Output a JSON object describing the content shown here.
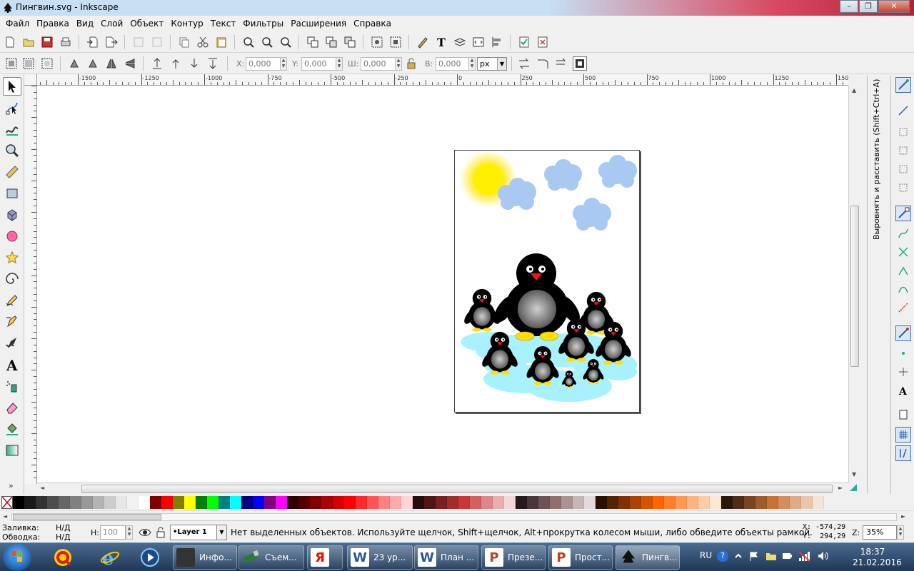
{
  "window": {
    "title": "Пингвин.svg - Inkscape"
  },
  "menu": [
    "Файл",
    "Правка",
    "Вид",
    "Слой",
    "Объект",
    "Контур",
    "Текст",
    "Фильтры",
    "Расширения",
    "Справка"
  ],
  "controls": {
    "x_label": "X:",
    "x_value": "0,000",
    "y_label": "Y:",
    "y_value": "0,000",
    "w_label": "Ш:",
    "w_value": "0,000",
    "h_label": "В:",
    "h_value": "0,000",
    "unit": "px"
  },
  "ruler": {
    "labels": [
      "-1500",
      "-1250",
      "-1000",
      "-750",
      "-500",
      "-250",
      "0",
      "250",
      "500",
      "750",
      "1000",
      "1250",
      "1500"
    ]
  },
  "dock": {
    "panel_title": "Выровнять и расставить (Shift+Ctrl+A)"
  },
  "status": {
    "fill_label": "Заливка:",
    "fill_value": "Н/Д",
    "stroke_label": "Обводка:",
    "stroke_value": "Н/Д",
    "opacity_label": "Н:",
    "opacity_value": "100",
    "layer": "•Layer 1",
    "message": "Нет выделенных объектов. Используйте щелчок, Shift+щелчок, Alt+прокрутка колесом мыши, либо обведите объекты рамкой.",
    "cursor_x": "X: -574,29",
    "cursor_y": "Y:  294,29",
    "zoom_label": "Z:",
    "zoom_value": "35%"
  },
  "palette": [
    "#000000",
    "#1a1a1a",
    "#333333",
    "#4d4d4d",
    "#666666",
    "#808080",
    "#999999",
    "#b3b3b3",
    "#cccccc",
    "#e6e6e6",
    "#f2f2f2",
    "#ffffff",
    "#800000",
    "#ff0000",
    "#808000",
    "#ffff00",
    "#008000",
    "#00ff00",
    "#008080",
    "#00ffff",
    "#000080",
    "#0000ff",
    "#800080",
    "#ff00ff",
    "#2b0000",
    "#550000",
    "#800000",
    "#aa0000",
    "#d40000",
    "#ff0000",
    "#ff2a2a",
    "#ff5555",
    "#ff8080",
    "#ffaaaa",
    "#ffd5d5",
    "#280b0b",
    "#501616",
    "#782121",
    "#a02c2c",
    "#c83737",
    "#d35f5f",
    "#de8787",
    "#e9afaf",
    "#f4d7d7",
    "#241c1c",
    "#483737",
    "#6c5353",
    "#916f6f",
    "#ac9393",
    "#c8b7b7",
    "#e3dbdb",
    "#2b1100",
    "#552200",
    "#803300",
    "#aa4400",
    "#d45500",
    "#ff6600",
    "#ff7f2a",
    "#ff9955",
    "#ffb380",
    "#ffccaa",
    "#ffe6d5",
    "#28170b",
    "#502d16",
    "#784421",
    "#a05a2c",
    "#c87137",
    "#d38d5f",
    "#deaa87",
    "#e9c6af",
    "#f4e3d7"
  ],
  "taskbar": {
    "tasks": [
      {
        "label": "Инфо...",
        "icon": "film-icon",
        "color": "#333333"
      },
      {
        "label": "Съем...",
        "icon": "usb-icon",
        "color": "#2a7a3a"
      },
      {
        "label": "",
        "icon": "yandex-icon",
        "color": "#ffffff"
      },
      {
        "label": "23 ур...",
        "icon": "word-icon",
        "color": "#2b579a"
      },
      {
        "label": "План ...",
        "icon": "word-icon",
        "color": "#2b579a"
      },
      {
        "label": "Презе...",
        "icon": "powerpoint-icon",
        "color": "#c43e1c"
      },
      {
        "label": "Прост...",
        "icon": "powerpoint-icon",
        "color": "#c43e1c"
      },
      {
        "label": "Пингв...",
        "icon": "inkscape-icon",
        "color": "#000000"
      }
    ],
    "lang": "RU",
    "time": "18:37",
    "date": "21.02.2016"
  }
}
